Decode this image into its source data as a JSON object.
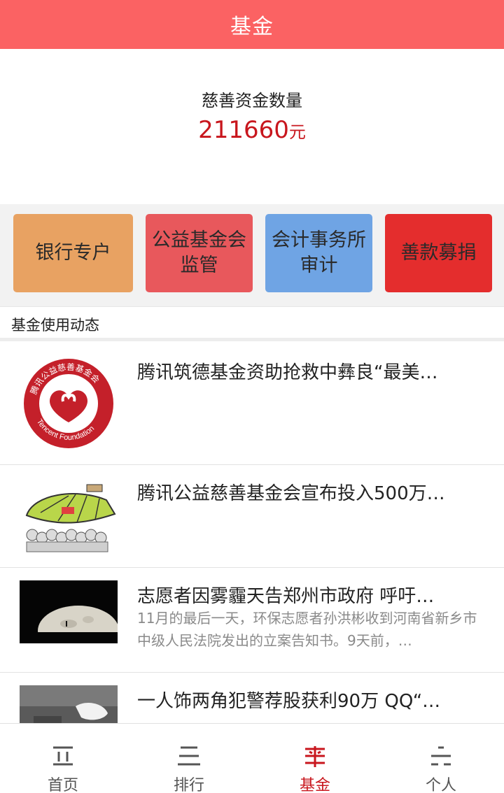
{
  "header": {
    "title": "基金"
  },
  "summary": {
    "label": "慈善资金数量",
    "amount": "211660",
    "unit": "元"
  },
  "buttons": [
    {
      "line1": "银行专户",
      "line2": ""
    },
    {
      "line1": "公益基金会",
      "line2": "监管"
    },
    {
      "line1": "会计事务所",
      "line2": "审计"
    },
    {
      "line1": "善款募捐",
      "line2": ""
    }
  ],
  "section": {
    "title": "基金使用动态"
  },
  "news": [
    {
      "title": "腾讯筑德基金资助抢救中彝良“最美…",
      "desc": "",
      "thumb_text": [
        "腾讯公益慈善基金会",
        "Tencent Foundation"
      ]
    },
    {
      "title": "腾讯公益慈善基金会宣布投入500万…",
      "desc": "",
      "thumb_text": ""
    },
    {
      "title": "志愿者因雾霾天告郑州市政府 呼吁…",
      "desc": "11月的最后一天，环保志愿者孙洪彬收到河南省新乡市中级人民法院发出的立案告知书。9天前，…",
      "thumb_text": ""
    },
    {
      "title": "一人饰两角犯警荐股获利90万 QQ“…",
      "desc": "",
      "thumb_text": ""
    }
  ],
  "tabs": [
    {
      "label": "首页",
      "icon": "home-icon"
    },
    {
      "label": "排行",
      "icon": "ranking-icon"
    },
    {
      "label": "基金",
      "icon": "fund-icon"
    },
    {
      "label": "个人",
      "icon": "person-icon"
    }
  ],
  "colors": {
    "header": "#fb6263",
    "accent": "#c8161d"
  }
}
